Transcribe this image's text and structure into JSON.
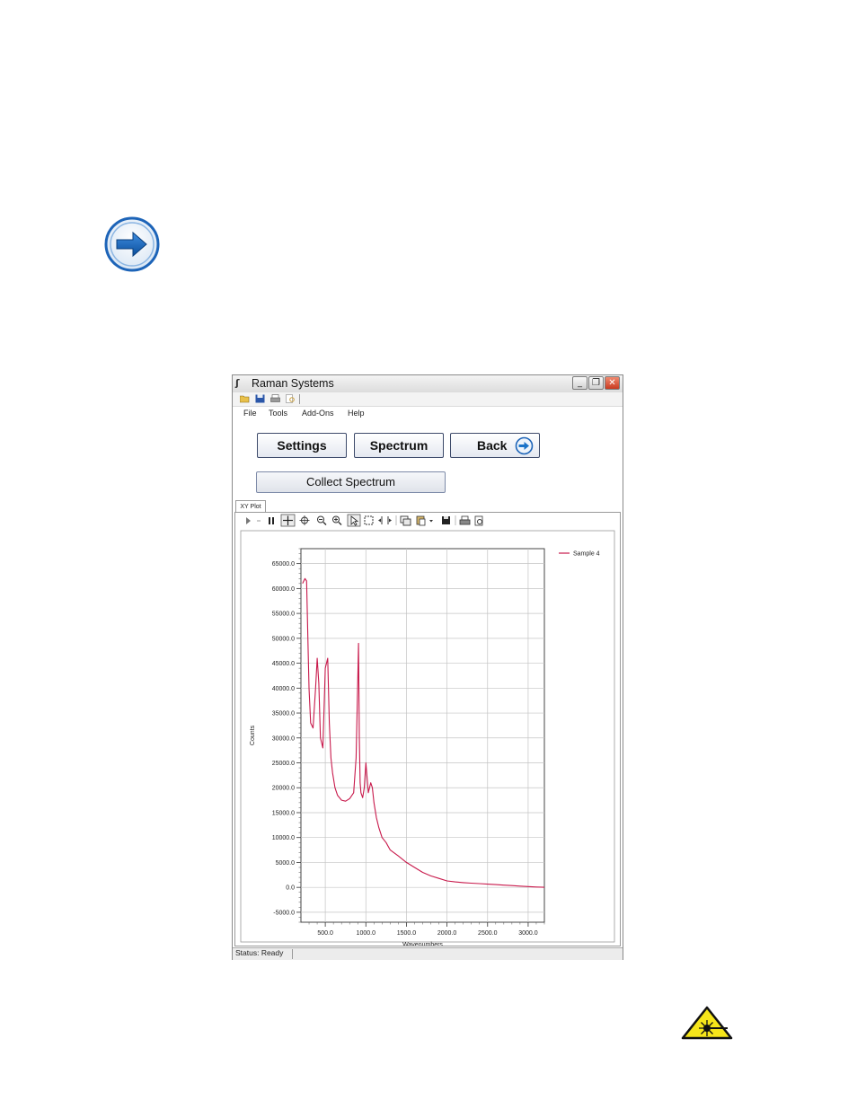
{
  "window": {
    "title": "Raman Systems",
    "minimize_glyph": "_",
    "restore_glyph": "❐",
    "close_glyph": "✕"
  },
  "toolbar_icons": [
    "open-folder-icon",
    "save-icon",
    "print-icon",
    "print-preview-icon"
  ],
  "menu": {
    "items": [
      "File",
      "Tools",
      "Add-Ons",
      "Help"
    ]
  },
  "buttons": {
    "settings": "Settings",
    "spectrum": "Spectrum",
    "back": "Back",
    "collect": "Collect Spectrum"
  },
  "tab": {
    "label": "XY Plot"
  },
  "plot_toolbar_icons": [
    "play-icon",
    "pause-icon",
    "crosshair-icon",
    "pan-icon",
    "zoom-out-icon",
    "zoom-in-icon",
    "select-icon",
    "zoom-box-icon",
    "x-scale-icon",
    "copy-icon",
    "paste-icon",
    "save-icon",
    "print-icon",
    "print-preview-icon"
  ],
  "status": {
    "text": "Status: Ready"
  },
  "colors": {
    "series": "#c8194b",
    "accent": "#1a73c8"
  },
  "chart_data": {
    "type": "line",
    "title": "",
    "xlabel": "Wavenumbers",
    "ylabel": "Counts",
    "xlim": [
      200,
      3200
    ],
    "ylim": [
      -7000,
      68000
    ],
    "x_ticks": [
      "500.0",
      "1000.0",
      "1500.0",
      "2000.0",
      "2500.0",
      "3000.0"
    ],
    "y_ticks": [
      "65000.0",
      "60000.0",
      "55000.0",
      "50000.0",
      "45000.0",
      "40000.0",
      "35000.0",
      "30000.0",
      "25000.0",
      "20000.0",
      "15000.0",
      "10000.0",
      "5000.0",
      "0.0",
      "-5000.0"
    ],
    "legend_position": "top-right",
    "grid": true,
    "series": [
      {
        "name": "Sample 4",
        "x": [
          220,
          250,
          270,
          290,
          300,
          320,
          350,
          380,
          400,
          420,
          440,
          470,
          500,
          530,
          550,
          570,
          590,
          620,
          650,
          700,
          750,
          800,
          850,
          880,
          900,
          910,
          920,
          930,
          940,
          960,
          980,
          1000,
          1010,
          1030,
          1060,
          1080,
          1100,
          1130,
          1160,
          1200,
          1250,
          1300,
          1400,
          1500,
          1600,
          1700,
          1800,
          1900,
          2000,
          2100,
          2200,
          2300,
          2400,
          2500,
          2600,
          2700,
          2800,
          2900,
          3000,
          3100,
          3200
        ],
        "y": [
          61000,
          62000,
          61500,
          47000,
          40000,
          33000,
          32000,
          40000,
          46000,
          41000,
          30000,
          28000,
          44000,
          46000,
          33000,
          26000,
          23000,
          20000,
          18500,
          17500,
          17300,
          17800,
          19000,
          26000,
          41000,
          49000,
          30000,
          21000,
          19000,
          18000,
          20000,
          25000,
          23000,
          19000,
          21000,
          20000,
          17000,
          14000,
          12000,
          10000,
          9000,
          7500,
          6300,
          5000,
          4000,
          3000,
          2300,
          1800,
          1300,
          1100,
          950,
          850,
          750,
          650,
          550,
          450,
          350,
          250,
          150,
          60,
          10
        ]
      }
    ]
  }
}
